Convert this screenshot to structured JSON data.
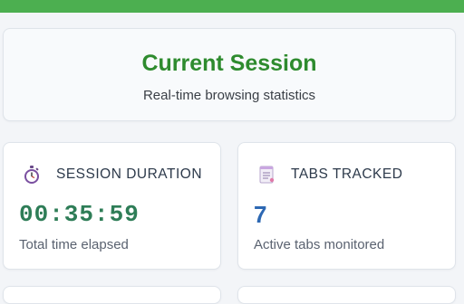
{
  "header": {
    "title": "Current Session",
    "subtitle": "Real-time browsing statistics"
  },
  "stats": [
    {
      "icon": "stopwatch-icon",
      "label": "SESSION DURATION",
      "value": "00:35:59",
      "caption": "Total time elapsed"
    },
    {
      "icon": "notepad-icon",
      "label": "TABS TRACKED",
      "value": "7",
      "caption": "Active tabs monitored"
    }
  ],
  "colors": {
    "accent_bar": "#4caf50",
    "title_green": "#2e8b2e",
    "duration_green": "#2e7d57",
    "tabs_blue": "#2d68b3"
  }
}
